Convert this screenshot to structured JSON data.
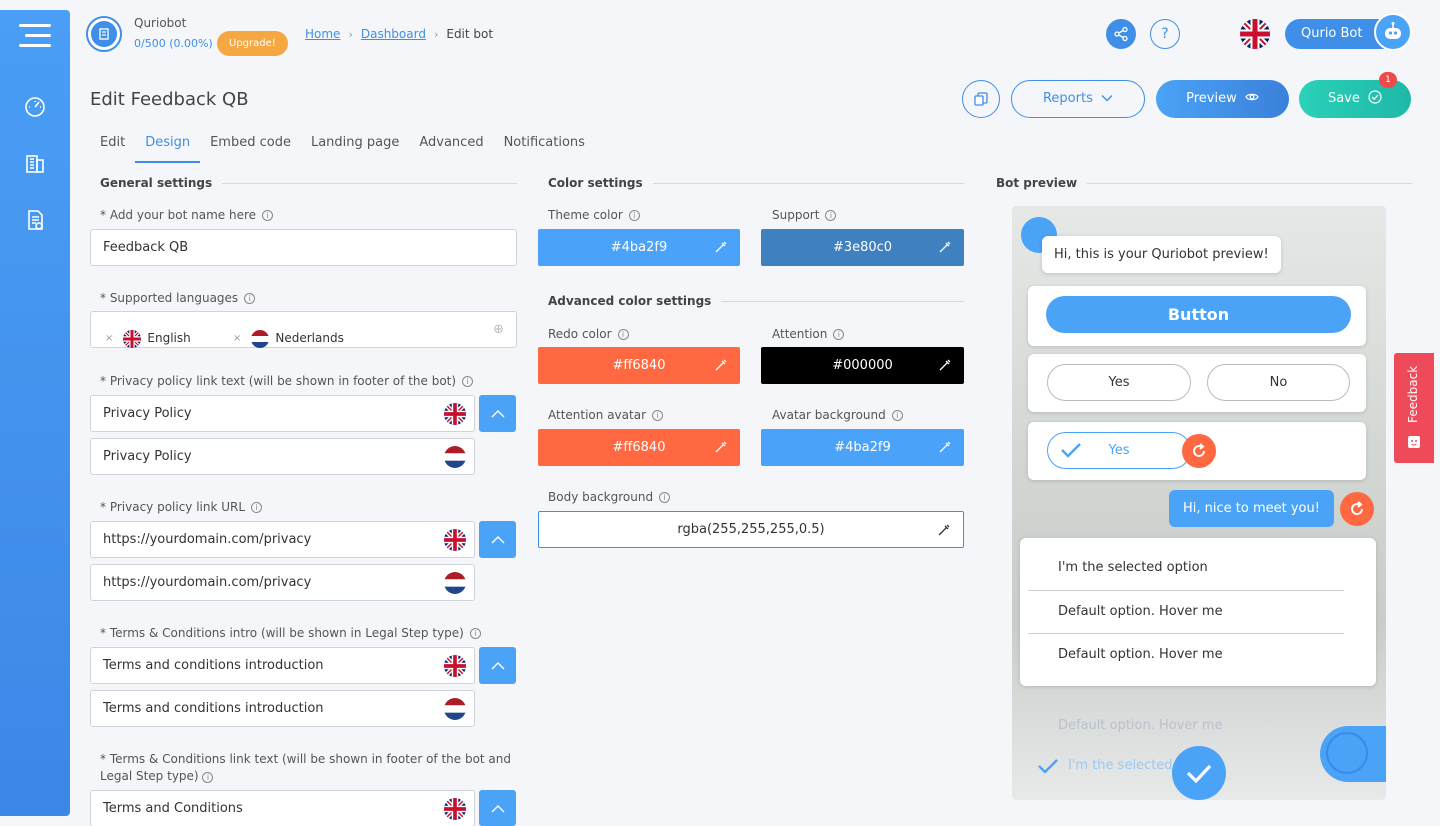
{
  "brand": {
    "name": "Quriobot",
    "usage": "0/500 (0.00%)",
    "upgrade": "Upgrade!"
  },
  "breadcrumb": {
    "home": "Home",
    "dashboard": "Dashboard",
    "current": "Edit bot"
  },
  "user": {
    "name": "Qurio Bot"
  },
  "page": {
    "title": "Edit Feedback QB"
  },
  "actions": {
    "reports": "Reports",
    "preview": "Preview",
    "save": "Save",
    "save_badge": "1"
  },
  "tabs": [
    "Edit",
    "Design",
    "Embed code",
    "Landing page",
    "Advanced",
    "Notifications"
  ],
  "general": {
    "title": "General settings",
    "bot_name_label": "* Add your bot name here",
    "bot_name": "Feedback QB",
    "languages_label": "* Supported languages",
    "languages": [
      "English",
      "Nederlands"
    ],
    "privacy_text_label": "* Privacy policy link text (will be shown in footer of the bot)",
    "privacy_text_en": "Privacy Policy",
    "privacy_text_nl": "Privacy Policy",
    "privacy_url_label": "* Privacy policy link URL",
    "privacy_url_en": "https://yourdomain.com/privacy",
    "privacy_url_nl": "https://yourdomain.com/privacy",
    "terms_intro_label": "* Terms & Conditions intro (will be shown in Legal Step type)",
    "terms_intro_en": "Terms and conditions introduction",
    "terms_intro_nl": "Terms and conditions introduction",
    "terms_link_label_1": "* Terms & Conditions link text (will be shown in footer of the bot and",
    "terms_link_label_2": "Legal Step type)",
    "terms_link_en": "Terms and Conditions"
  },
  "colors": {
    "title": "Color settings",
    "theme_label": "Theme color",
    "theme": "#4ba2f9",
    "support_label": "Support",
    "support": "#3e80c0",
    "advanced_title": "Advanced color settings",
    "redo_label": "Redo color",
    "redo": "#ff6840",
    "attention_label": "Attention",
    "attention": "#000000",
    "attention_avatar_label": "Attention avatar",
    "attention_avatar": "#ff6840",
    "avatar_bg_label": "Avatar background",
    "avatar_bg": "#4ba2f9",
    "body_bg_label": "Body background",
    "body_bg": "rgba(255,255,255,0.5)"
  },
  "preview": {
    "title": "Bot preview",
    "greeting": "Hi, this is your Quriobot preview!",
    "button": "Button",
    "yes": "Yes",
    "no": "No",
    "selected_yes": "Yes",
    "user_reply": "Hi, nice to meet you!",
    "options": [
      "I'm the selected option",
      "Default option. Hover me",
      "Default option. Hover me"
    ],
    "faded_option": "Default option. Hover me",
    "faded_selected": "I'm the selected"
  },
  "feedback_tab": "Feedback"
}
